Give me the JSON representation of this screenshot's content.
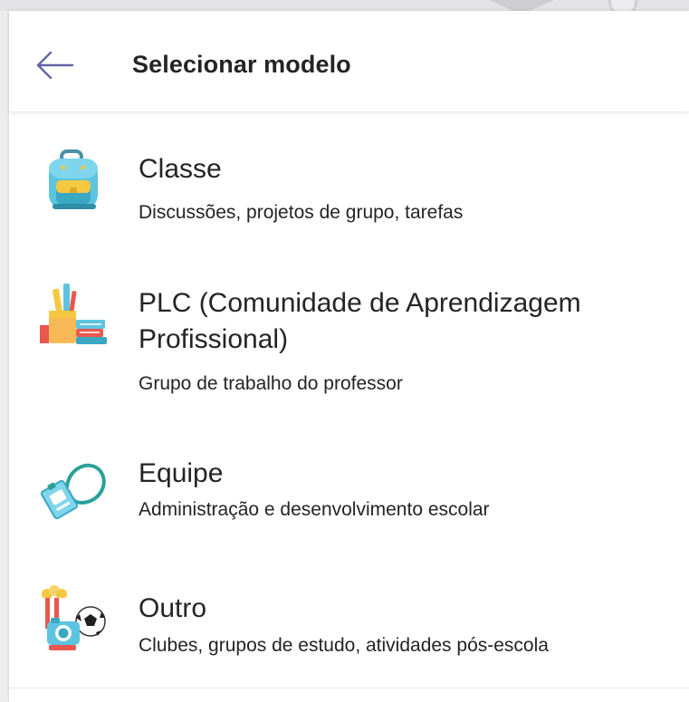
{
  "header": {
    "title": "Selecionar modelo",
    "back_icon": "arrow-left-icon",
    "accent": "#6264a7"
  },
  "templates": [
    {
      "title": "Classe",
      "description": "Discussões, projetos de grupo, tarefas",
      "icon": "backpack-icon"
    },
    {
      "title": "PLC (Comunidade de Aprendizagem Profissional)",
      "description": "Grupo de trabalho do professor",
      "icon": "pencil-cup-books-icon"
    },
    {
      "title": "Equipe",
      "description": "Administração e desenvolvimento escolar",
      "icon": "id-badge-lanyard-icon"
    },
    {
      "title": "Outro",
      "description": "Clubes, grupos de estudo, atividades pós-escola",
      "icon": "popcorn-camera-ball-icon"
    }
  ]
}
